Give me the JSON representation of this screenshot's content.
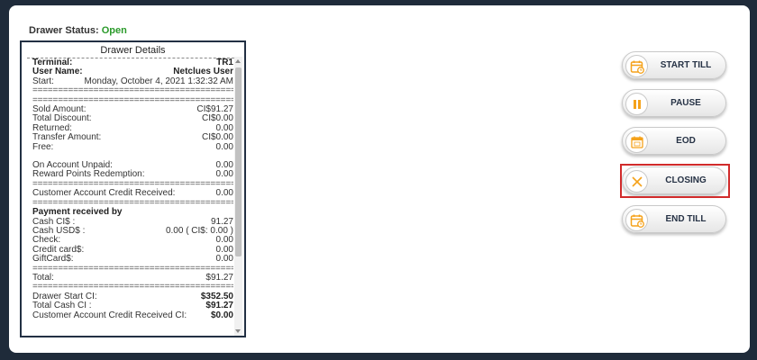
{
  "status": {
    "label": "Drawer Status:",
    "value": "Open"
  },
  "details": {
    "title": "Drawer Details",
    "terminal_label": "Terminal:",
    "terminal_value": "TR1",
    "user_label": "User Name:",
    "user_value": "Netclues User",
    "start_label": "Start:",
    "start_value": "Monday, October 4, 2021 1:32:32 AM",
    "separator": "========================================",
    "sold_label": "Sold Amount:",
    "sold_value": "CI$91.27",
    "discount_label": "Total Discount:",
    "discount_value": "CI$0.00",
    "returned_label": "Returned:",
    "returned_value": "0.00",
    "transfer_label": "Transfer Amount:",
    "transfer_value": "CI$0.00",
    "free_label": "Free:",
    "free_value": "0.00",
    "unpaid_label": "On Account Unpaid:",
    "unpaid_value": "0.00",
    "reward_label": "Reward Points Redemption:",
    "reward_value": "0.00",
    "credit_label": "Customer Account Credit Received:",
    "credit_value": "0.00",
    "payment_heading": "Payment received by",
    "cash_ci_label": "Cash CI$ :",
    "cash_ci_value": "91.27",
    "cash_usd_label": "Cash USD$ :",
    "cash_usd_value": "0.00 ( CI$: 0.00 )",
    "check_label": "Check:",
    "check_value": "0.00",
    "card_label": "Credit card$:",
    "card_value": "0.00",
    "gift_label": "GiftCard$:",
    "gift_value": "0.00",
    "total_label": "Total:",
    "total_value": "$91.27",
    "drawer_start_label": "Drawer Start CI:",
    "drawer_start_value": "$352.50",
    "total_cash_label": "Total Cash CI :",
    "total_cash_value": "$91.27",
    "credit2_label": "Customer Account Credit Received CI:",
    "credit2_value": "$0.00"
  },
  "buttons": {
    "start_till": "START TILL",
    "pause": "PAUSE",
    "eod": "EOD",
    "closing": "CLOSING",
    "end_till": "END TILL"
  },
  "colors": {
    "accent": "#f5a21b",
    "status_open": "#2a9a2a",
    "highlight": "#d12b2b",
    "frame_bg": "#1f2b3a"
  },
  "icons": {
    "start_till": "calendar-clock-icon",
    "pause": "pause-icon",
    "eod": "calendar-icon",
    "closing": "close-icon",
    "end_till": "calendar-clock-icon"
  }
}
